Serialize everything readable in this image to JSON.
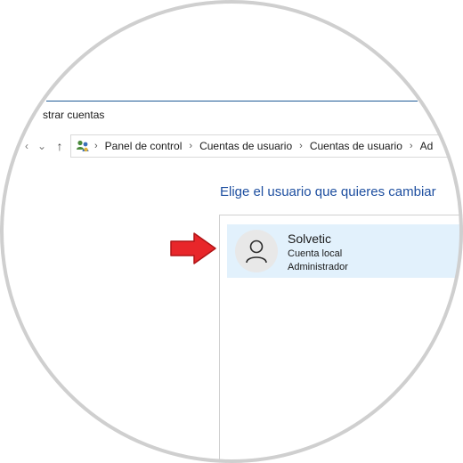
{
  "window": {
    "title": "strar cuentas"
  },
  "nav": {
    "back_glyph": "‹",
    "dropdown_glyph": "⌄",
    "up_glyph": "↑"
  },
  "breadcrumb": {
    "icon": "control-panel-users-icon",
    "items": [
      "Panel de control",
      "Cuentas de usuario",
      "Cuentas de usuario",
      "Ad"
    ]
  },
  "main": {
    "heading": "Elige el usuario que quieres cambiar",
    "account": {
      "name": "Solvetic",
      "type": "Cuenta local",
      "role": "Administrador",
      "tile_color": "#e2f1fc"
    }
  },
  "annotation": {
    "arrow_color": "#e8262a",
    "arrow_icon": "right-arrow-icon"
  }
}
